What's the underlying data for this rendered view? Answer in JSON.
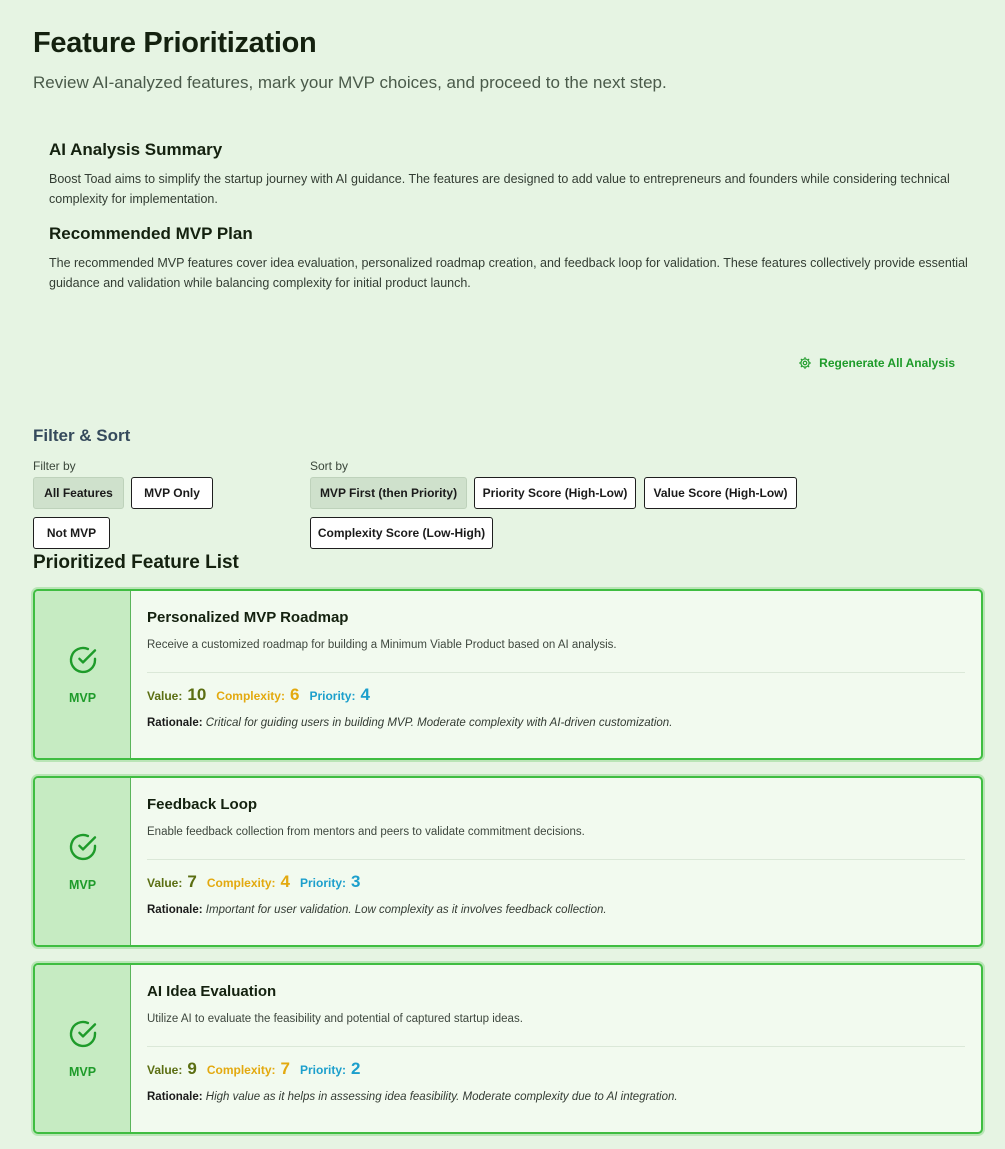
{
  "header": {
    "title": "Feature Prioritization",
    "subtitle": "Review AI-analyzed features, mark your MVP choices, and proceed to the next step."
  },
  "summary": {
    "analysis_heading": "AI Analysis Summary",
    "analysis_text": "Boost Toad aims to simplify the startup journey with AI guidance. The features are designed to add value to entrepreneurs and founders while considering technical complexity for implementation.",
    "mvp_heading": "Recommended MVP Plan",
    "mvp_text": "The recommended MVP features cover idea evaluation, personalized roadmap creation, and feedback loop for validation. These features collectively provide essential guidance and validation while balancing complexity for initial product launch."
  },
  "regenerate": {
    "label": "Regenerate All Analysis",
    "icon": "gear-icon"
  },
  "filter_sort": {
    "title": "Filter & Sort",
    "filter_label": "Filter by",
    "filters": [
      "All Features",
      "MVP Only",
      "Not MVP"
    ],
    "active_filter": "All Features",
    "sort_label": "Sort by",
    "sorts": [
      "MVP First (then Priority)",
      "Priority Score (High-Low)",
      "Value Score (High-Low)",
      "Complexity Score (Low-High)"
    ],
    "active_sort": "MVP First (then Priority)"
  },
  "list": {
    "title": "Prioritized Feature List",
    "value_label": "Value:",
    "complexity_label": "Complexity:",
    "priority_label": "Priority:",
    "rationale_label": "Rationale:",
    "features": [
      {
        "badge": "MVP",
        "name": "Personalized MVP Roadmap",
        "description": "Receive a customized roadmap for building a Minimum Viable Product based on AI analysis.",
        "value": "10",
        "complexity": "6",
        "priority": "4",
        "rationale": "Critical for guiding users in building MVP. Moderate complexity with AI-driven customization."
      },
      {
        "badge": "MVP",
        "name": "Feedback Loop",
        "description": "Enable feedback collection from mentors and peers to validate commitment decisions.",
        "value": "7",
        "complexity": "4",
        "priority": "3",
        "rationale": "Important for user validation. Low complexity as it involves feedback collection."
      },
      {
        "badge": "MVP",
        "name": "AI Idea Evaluation",
        "description": "Utilize AI to evaluate the feasibility and potential of captured startup ideas.",
        "value": "9",
        "complexity": "7",
        "priority": "2",
        "rationale": "High value as it helps in assessing idea feasibility. Moderate complexity due to AI integration."
      }
    ]
  },
  "colors": {
    "accent": "#1e9b2a",
    "card_border": "#3fbd41",
    "value": "#5b6e12",
    "complexity": "#e3a90f",
    "priority": "#1c9fcc"
  }
}
